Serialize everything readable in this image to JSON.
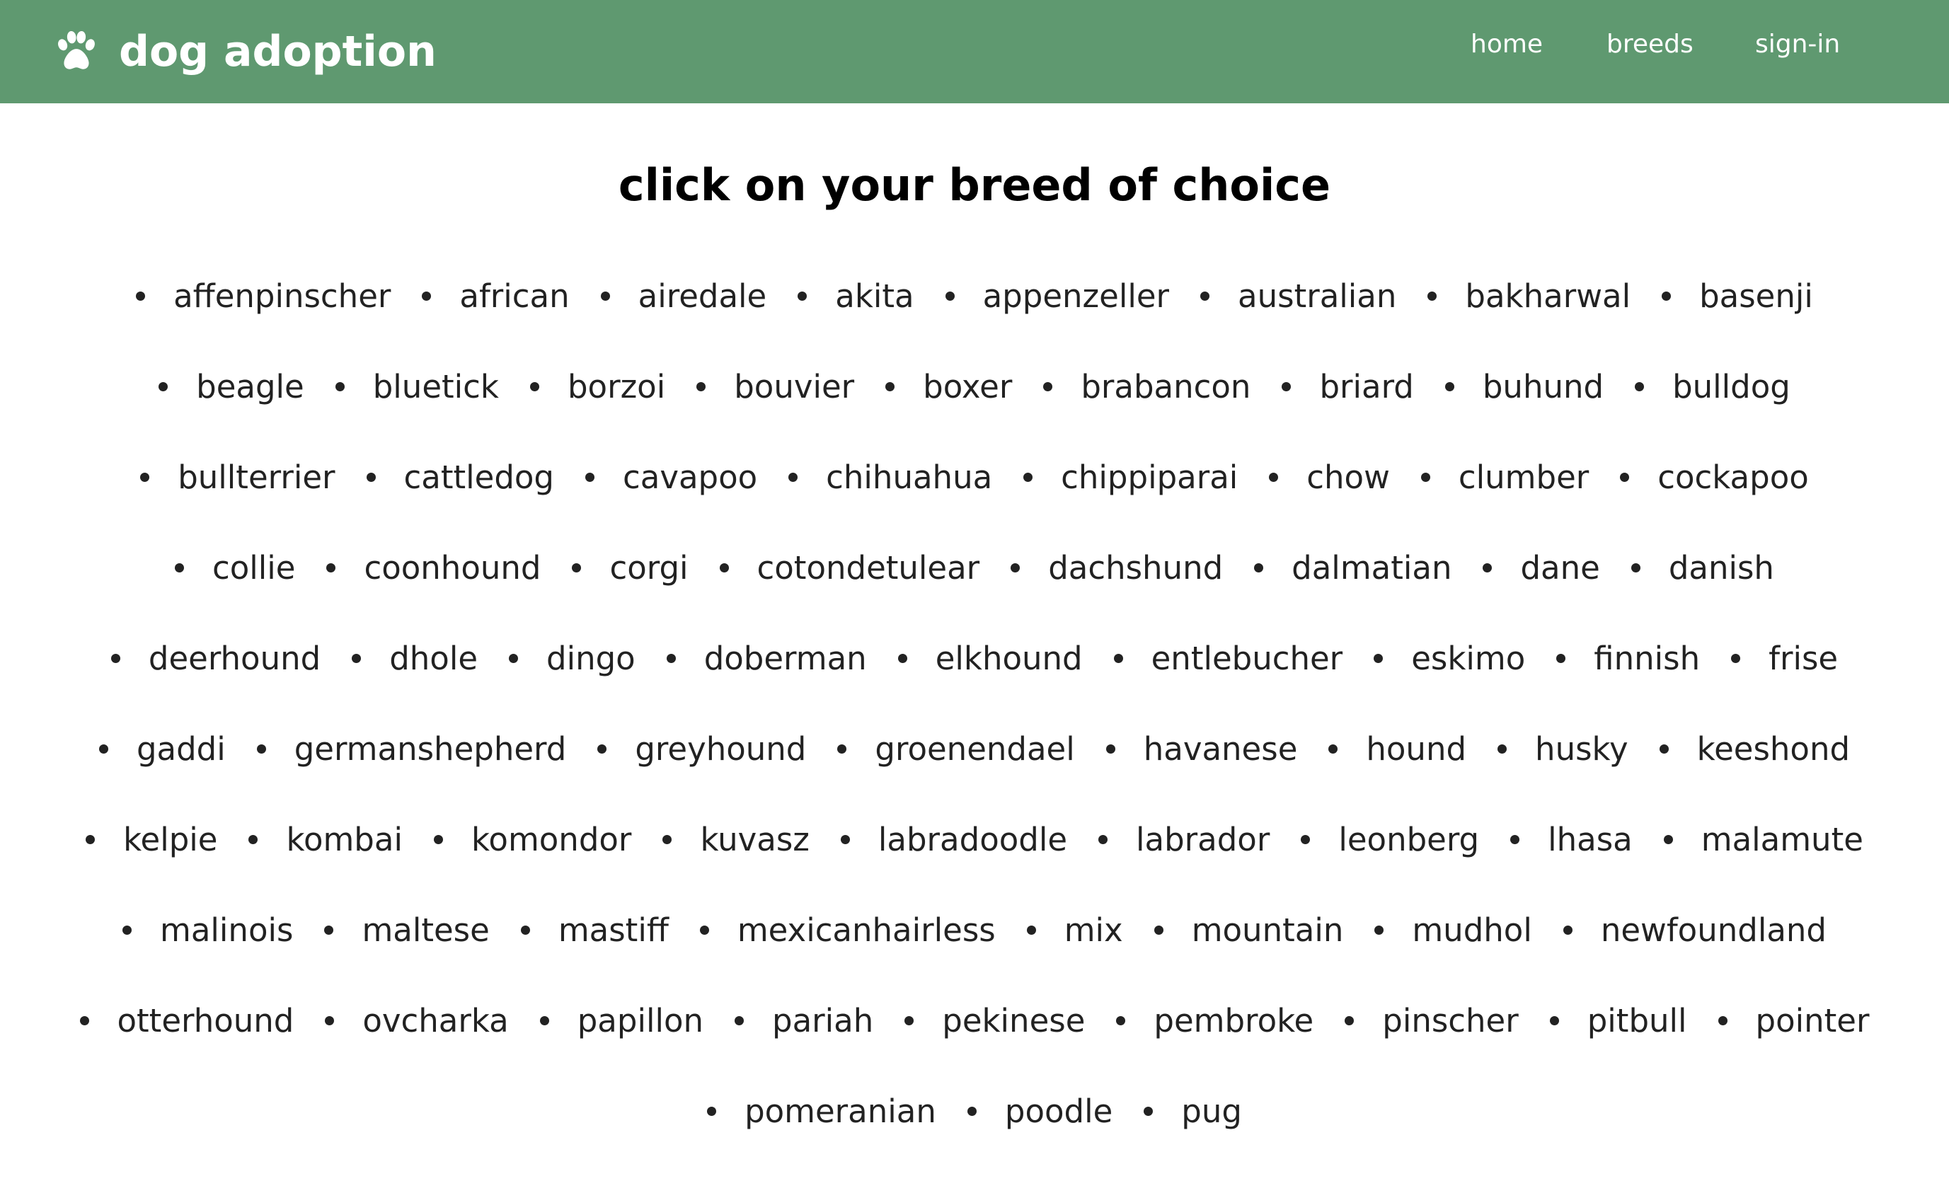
{
  "header": {
    "title": "dog adoption",
    "icon": "paw-icon",
    "background": "#5f9970",
    "nav": [
      {
        "label": "home"
      },
      {
        "label": "breeds"
      },
      {
        "label": "sign-in"
      }
    ]
  },
  "main": {
    "heading": "click on your breed of choice",
    "breeds": [
      "affenpinscher",
      "african",
      "airedale",
      "akita",
      "appenzeller",
      "australian",
      "bakharwal",
      "basenji",
      "beagle",
      "bluetick",
      "borzoi",
      "bouvier",
      "boxer",
      "brabancon",
      "briard",
      "buhund",
      "bulldog",
      "bullterrier",
      "cattledog",
      "cavapoo",
      "chihuahua",
      "chippiparai",
      "chow",
      "clumber",
      "cockapoo",
      "collie",
      "coonhound",
      "corgi",
      "cotondetulear",
      "dachshund",
      "dalmatian",
      "dane",
      "danish",
      "deerhound",
      "dhole",
      "dingo",
      "doberman",
      "elkhound",
      "entlebucher",
      "eskimo",
      "finnish",
      "frise",
      "gaddi",
      "germanshepherd",
      "greyhound",
      "groenendael",
      "havanese",
      "hound",
      "husky",
      "keeshond",
      "kelpie",
      "kombai",
      "komondor",
      "kuvasz",
      "labradoodle",
      "labrador",
      "leonberg",
      "lhasa",
      "malamute",
      "malinois",
      "maltese",
      "mastiff",
      "mexicanhairless",
      "mix",
      "mountain",
      "mudhol",
      "newfoundland",
      "otterhound",
      "ovcharka",
      "papillon",
      "pariah",
      "pekinese",
      "pembroke",
      "pinscher",
      "pitbull",
      "pointer",
      "pomeranian",
      "poodle",
      "pug"
    ]
  }
}
